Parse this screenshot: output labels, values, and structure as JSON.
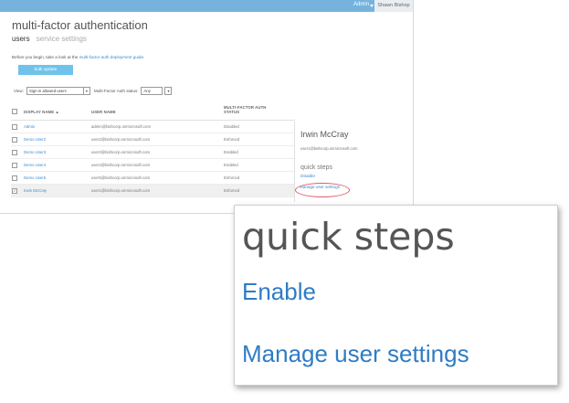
{
  "topbar": {
    "admin_label": "Admin",
    "user_label": "Shawn Bishop"
  },
  "page": {
    "title": "multi-factor authentication",
    "tabs": [
      {
        "label": "users"
      },
      {
        "label": "service settings"
      }
    ],
    "intro_prefix": "Before you begin, take a look at the ",
    "intro_link": "multi-factor auth deployment guide.",
    "bulk_update_label": "bulk update"
  },
  "filters": {
    "view_label": "View:",
    "view_value": "Sign-in allowed users",
    "status_label": "Multi-Factor Auth status:",
    "status_value": "Any"
  },
  "table": {
    "headers": {
      "display_name": "DISPLAY NAME ▲",
      "user_name": "USER NAME",
      "status_line1": "MULTI-FACTOR AUTH",
      "status_line2": "STATUS"
    },
    "rows": [
      {
        "name": "Admin",
        "user": "admin@bishcorp.onmicrosoft.com",
        "status": "Disabled",
        "checked": false
      },
      {
        "name": "Demo User2",
        "user": "user2@bishcorp.onmicrosoft.com",
        "status": "Enforced",
        "checked": false
      },
      {
        "name": "Demo User3",
        "user": "user3@bishcorp.onmicrosoft.com",
        "status": "Enabled",
        "checked": false
      },
      {
        "name": "Demo User4",
        "user": "user4@bishcorp.onmicrosoft.com",
        "status": "Enabled",
        "checked": false
      },
      {
        "name": "Demo User5",
        "user": "user5@bishcorp.onmicrosoft.com",
        "status": "Enforced",
        "checked": false
      },
      {
        "name": "Irwin McCray",
        "user": "user1@bishcorp.onmicrosoft.com",
        "status": "Enforced",
        "checked": true
      }
    ]
  },
  "detail": {
    "name": "Irwin McCray",
    "email": "user1@bishcorp.onmicrosoft.com",
    "quick_steps": "quick steps",
    "enable": "Disable",
    "manage": "Manage user settings"
  },
  "callout": {
    "quick_steps": "quick steps",
    "enable": "Enable",
    "manage": "Manage user settings"
  },
  "colors": {
    "topbar": "#75b3de",
    "link": "#3a8bd1",
    "button": "#6fc3ea",
    "highlight": "#e05a6a"
  }
}
